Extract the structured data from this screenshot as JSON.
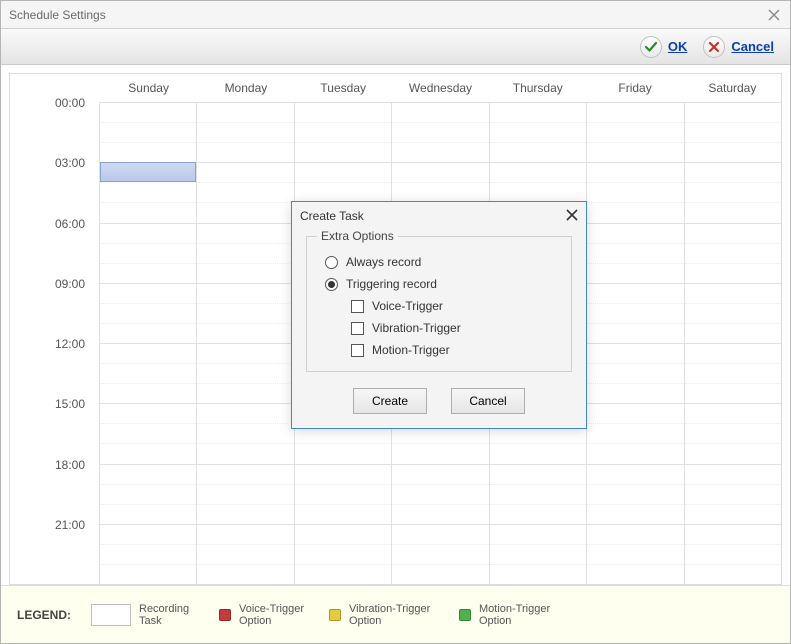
{
  "window": {
    "title": "Schedule Settings"
  },
  "actions": {
    "ok": "OK",
    "cancel": "Cancel"
  },
  "days": [
    "Sunday",
    "Monday",
    "Tuesday",
    "Wednesday",
    "Thursday",
    "Friday",
    "Saturday"
  ],
  "timeLabels": [
    "00:00",
    "03:00",
    "06:00",
    "09:00",
    "12:00",
    "15:00",
    "18:00",
    "21:00"
  ],
  "selection": {
    "dayIndex": 0,
    "slot": 1
  },
  "modal": {
    "title": "Create Task",
    "groupTitle": "Extra Options",
    "radios": {
      "always": "Always record",
      "triggering": "Triggering record",
      "selected": "triggering"
    },
    "checks": {
      "voice": "Voice-Trigger",
      "vibration": "Vibration-Trigger",
      "motion": "Motion-Trigger"
    },
    "buttons": {
      "create": "Create",
      "cancel": "Cancel"
    }
  },
  "legend": {
    "title": "LEGEND:",
    "items": {
      "recording": "Recording Task",
      "voice": "Voice-Trigger Option",
      "vibration": "Vibration-Trigger Option",
      "motion": "Motion-Trigger Option"
    },
    "colors": {
      "voice": "#c43b3b",
      "vibration": "#e7c93e",
      "motion": "#4fb24f"
    }
  }
}
